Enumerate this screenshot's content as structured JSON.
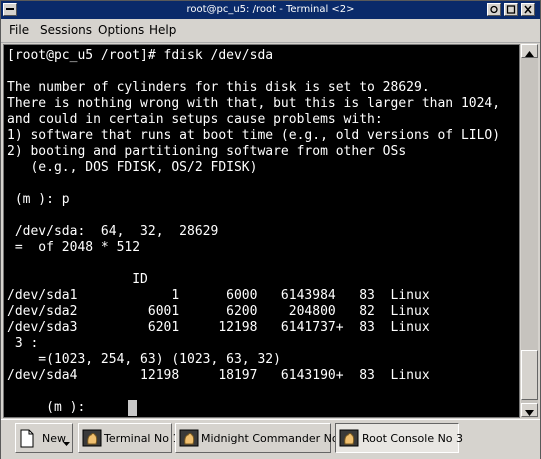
{
  "window": {
    "title": "root@pc_u5: /root - Terminal <2>"
  },
  "menu": [
    "File",
    "Sessions",
    "Options",
    "Help"
  ],
  "terminal": {
    "lines": [
      "[root@pc_u5 /root]# fdisk /dev/sda",
      "",
      "The number of cylinders for this disk is set to 28629.",
      "There is nothing wrong with that, but this is larger than 1024,",
      "and could in certain setups cause problems with:",
      "1) software that runs at boot time (e.g., old versions of LILO)",
      "2) booting and partitioning software from other OSs",
      "   (e.g., DOS FDISK, OS/2 FDISK)",
      "",
      " (m ): p",
      "",
      " /dev/sda:  64,  32,  28629",
      " =  of 2048 * 512",
      "",
      "                ID",
      "/dev/sda1            1      6000   6143984   83  Linux",
      "/dev/sda2         6001      6200    204800   82  Linux",
      "/dev/sda3         6201     12198   6141737+  83  Linux",
      " 3 :",
      "    =(1023, 254, 63) (1023, 63, 32)",
      "/dev/sda4        12198     18197   6143190+  83  Linux",
      "",
      "     (m ):"
    ]
  },
  "taskbar": {
    "new_label": "New",
    "tabs": [
      {
        "label": "Terminal No 1",
        "active": false
      },
      {
        "label": "Midnight Commander No 2",
        "active": false
      },
      {
        "label": "Root Console No 3",
        "active": true
      }
    ]
  },
  "icons": {
    "title_menu": "menu-icon",
    "minimize": "minimize-icon",
    "maximize": "maximize-icon",
    "close": "close-icon",
    "new": "new-document-icon",
    "tab": "shell-icon"
  }
}
